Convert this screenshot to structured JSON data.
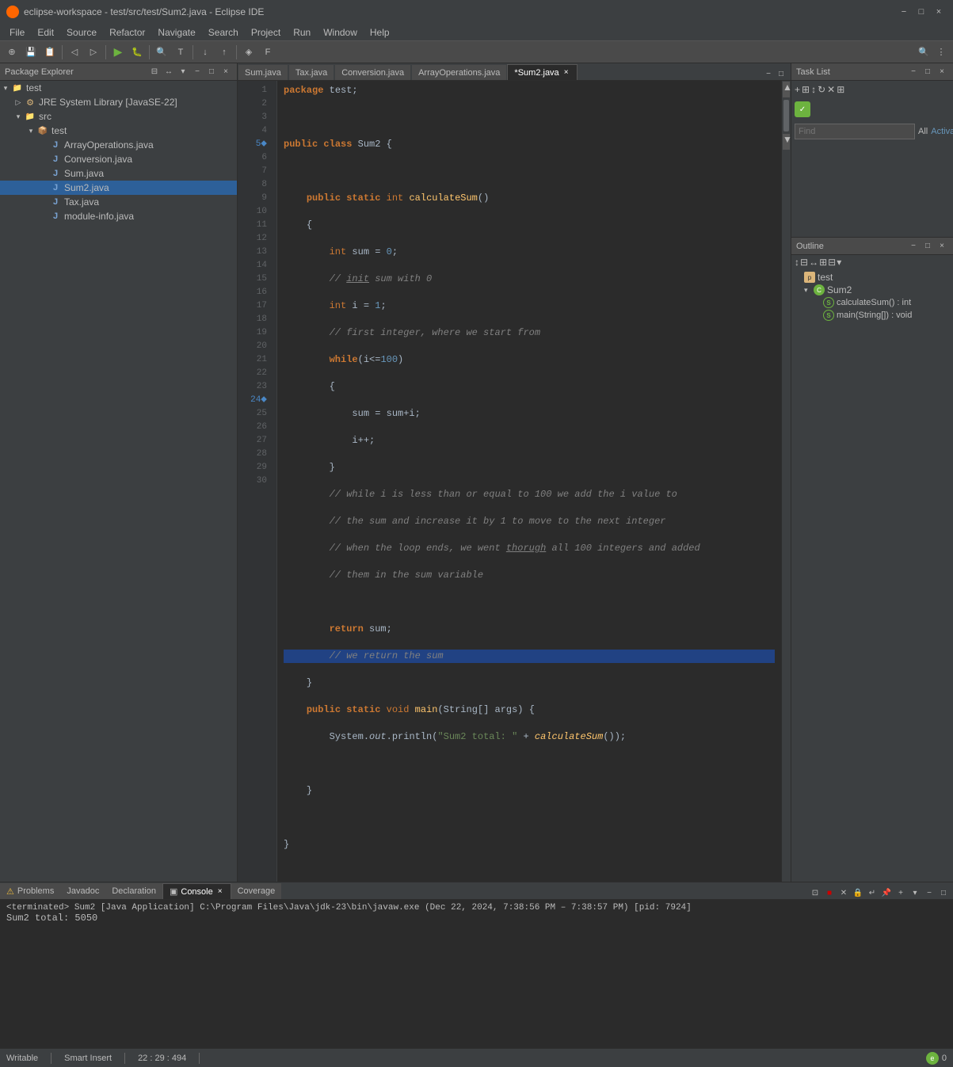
{
  "titleBar": {
    "title": "eclipse-workspace - test/src/test/Sum2.java - Eclipse IDE",
    "icon": "eclipse-icon",
    "minimize": "−",
    "maximize": "□",
    "close": "×"
  },
  "menuBar": {
    "items": [
      "File",
      "Edit",
      "Source",
      "Refactor",
      "Navigate",
      "Search",
      "Project",
      "Run",
      "Window",
      "Help"
    ]
  },
  "packageExplorer": {
    "title": "Package Explorer",
    "tree": {
      "test_project": "test",
      "jre": "JRE System Library [JavaSE-22]",
      "src": "src",
      "test_pkg": "test",
      "array_ops": "ArrayOperations.java",
      "conversion": "Conversion.java",
      "sum": "Sum.java",
      "sum2": "Sum2.java",
      "tax": "Tax.java",
      "module_info": "module-info.java"
    }
  },
  "editorTabs": {
    "tabs": [
      {
        "label": "Sum.java",
        "active": false,
        "modified": false
      },
      {
        "label": "Tax.java",
        "active": false,
        "modified": false
      },
      {
        "label": "Conversion.java",
        "active": false,
        "modified": false
      },
      {
        "label": "ArrayOperations.java",
        "active": false,
        "modified": false
      },
      {
        "label": "*Sum2.java",
        "active": true,
        "modified": true
      }
    ]
  },
  "codeEditor": {
    "lines": [
      {
        "num": 1,
        "content": "package test;",
        "type": "normal"
      },
      {
        "num": 2,
        "content": "",
        "type": "normal"
      },
      {
        "num": 3,
        "content": "public class Sum2 {",
        "type": "normal"
      },
      {
        "num": 4,
        "content": "",
        "type": "normal"
      },
      {
        "num": 5,
        "content": "    public static int calculateSum()",
        "type": "normal"
      },
      {
        "num": 6,
        "content": "    {",
        "type": "normal"
      },
      {
        "num": 7,
        "content": "        int sum = 0;",
        "type": "normal"
      },
      {
        "num": 8,
        "content": "        // init sum with 0",
        "type": "comment"
      },
      {
        "num": 9,
        "content": "        int i = 1;",
        "type": "normal"
      },
      {
        "num": 10,
        "content": "        // first integer, where we start from",
        "type": "comment"
      },
      {
        "num": 11,
        "content": "        while(i<=100)",
        "type": "normal"
      },
      {
        "num": 12,
        "content": "        {",
        "type": "normal"
      },
      {
        "num": 13,
        "content": "            sum = sum+i;",
        "type": "normal"
      },
      {
        "num": 14,
        "content": "            i++;",
        "type": "normal"
      },
      {
        "num": 15,
        "content": "        }",
        "type": "normal"
      },
      {
        "num": 16,
        "content": "        // while i is less than or equal to 100 we add the i value to",
        "type": "comment"
      },
      {
        "num": 17,
        "content": "        // the sum and increase it by 1 to move to the next integer",
        "type": "comment"
      },
      {
        "num": 18,
        "content": "        // when the loop ends, we went thorugh all 100 integers and added",
        "type": "comment"
      },
      {
        "num": 19,
        "content": "        // them in the sum variable",
        "type": "comment"
      },
      {
        "num": 20,
        "content": "",
        "type": "normal"
      },
      {
        "num": 21,
        "content": "        return sum;",
        "type": "normal"
      },
      {
        "num": 22,
        "content": "        // we return the sum",
        "type": "comment",
        "highlighted": true
      },
      {
        "num": 23,
        "content": "    }",
        "type": "normal"
      },
      {
        "num": 24,
        "content": "    public static void main(String[] args) {",
        "type": "normal"
      },
      {
        "num": 25,
        "content": "        System.out.println(\"Sum2 total: \" + calculateSum());",
        "type": "normal"
      },
      {
        "num": 26,
        "content": "",
        "type": "normal"
      },
      {
        "num": 27,
        "content": "    }",
        "type": "normal"
      },
      {
        "num": 28,
        "content": "",
        "type": "normal"
      },
      {
        "num": 29,
        "content": "}",
        "type": "normal"
      },
      {
        "num": 30,
        "content": "",
        "type": "normal"
      }
    ]
  },
  "taskList": {
    "title": "Task List"
  },
  "findBar": {
    "placeholder": "Find",
    "all_label": "All",
    "activate_label": "Activate..."
  },
  "outline": {
    "title": "Outline",
    "items": {
      "test": "test",
      "sum2": "Sum2",
      "calculateSum": "calculateSum() : int",
      "main": "main(String[]) : void"
    }
  },
  "bottomTabs": {
    "tabs": [
      {
        "label": "Problems",
        "active": false,
        "icon": "warning-icon"
      },
      {
        "label": "Javadoc",
        "active": false,
        "icon": "javadoc-icon"
      },
      {
        "label": "Declaration",
        "active": false,
        "icon": "declaration-icon"
      },
      {
        "label": "Console",
        "active": true,
        "icon": "console-icon"
      },
      {
        "label": "Coverage",
        "active": false,
        "icon": "coverage-icon"
      }
    ]
  },
  "console": {
    "terminated": "<terminated> Sum2 [Java Application] C:\\Program Files\\Java\\jdk-23\\bin\\javaw.exe (Dec 22, 2024, 7:38:56 PM – 7:38:57 PM) [pid: 7924]",
    "output": "Sum2 total: 5050"
  },
  "statusBar": {
    "writable": "Writable",
    "insert_mode": "Smart Insert",
    "position": "22 : 29 : 494"
  }
}
